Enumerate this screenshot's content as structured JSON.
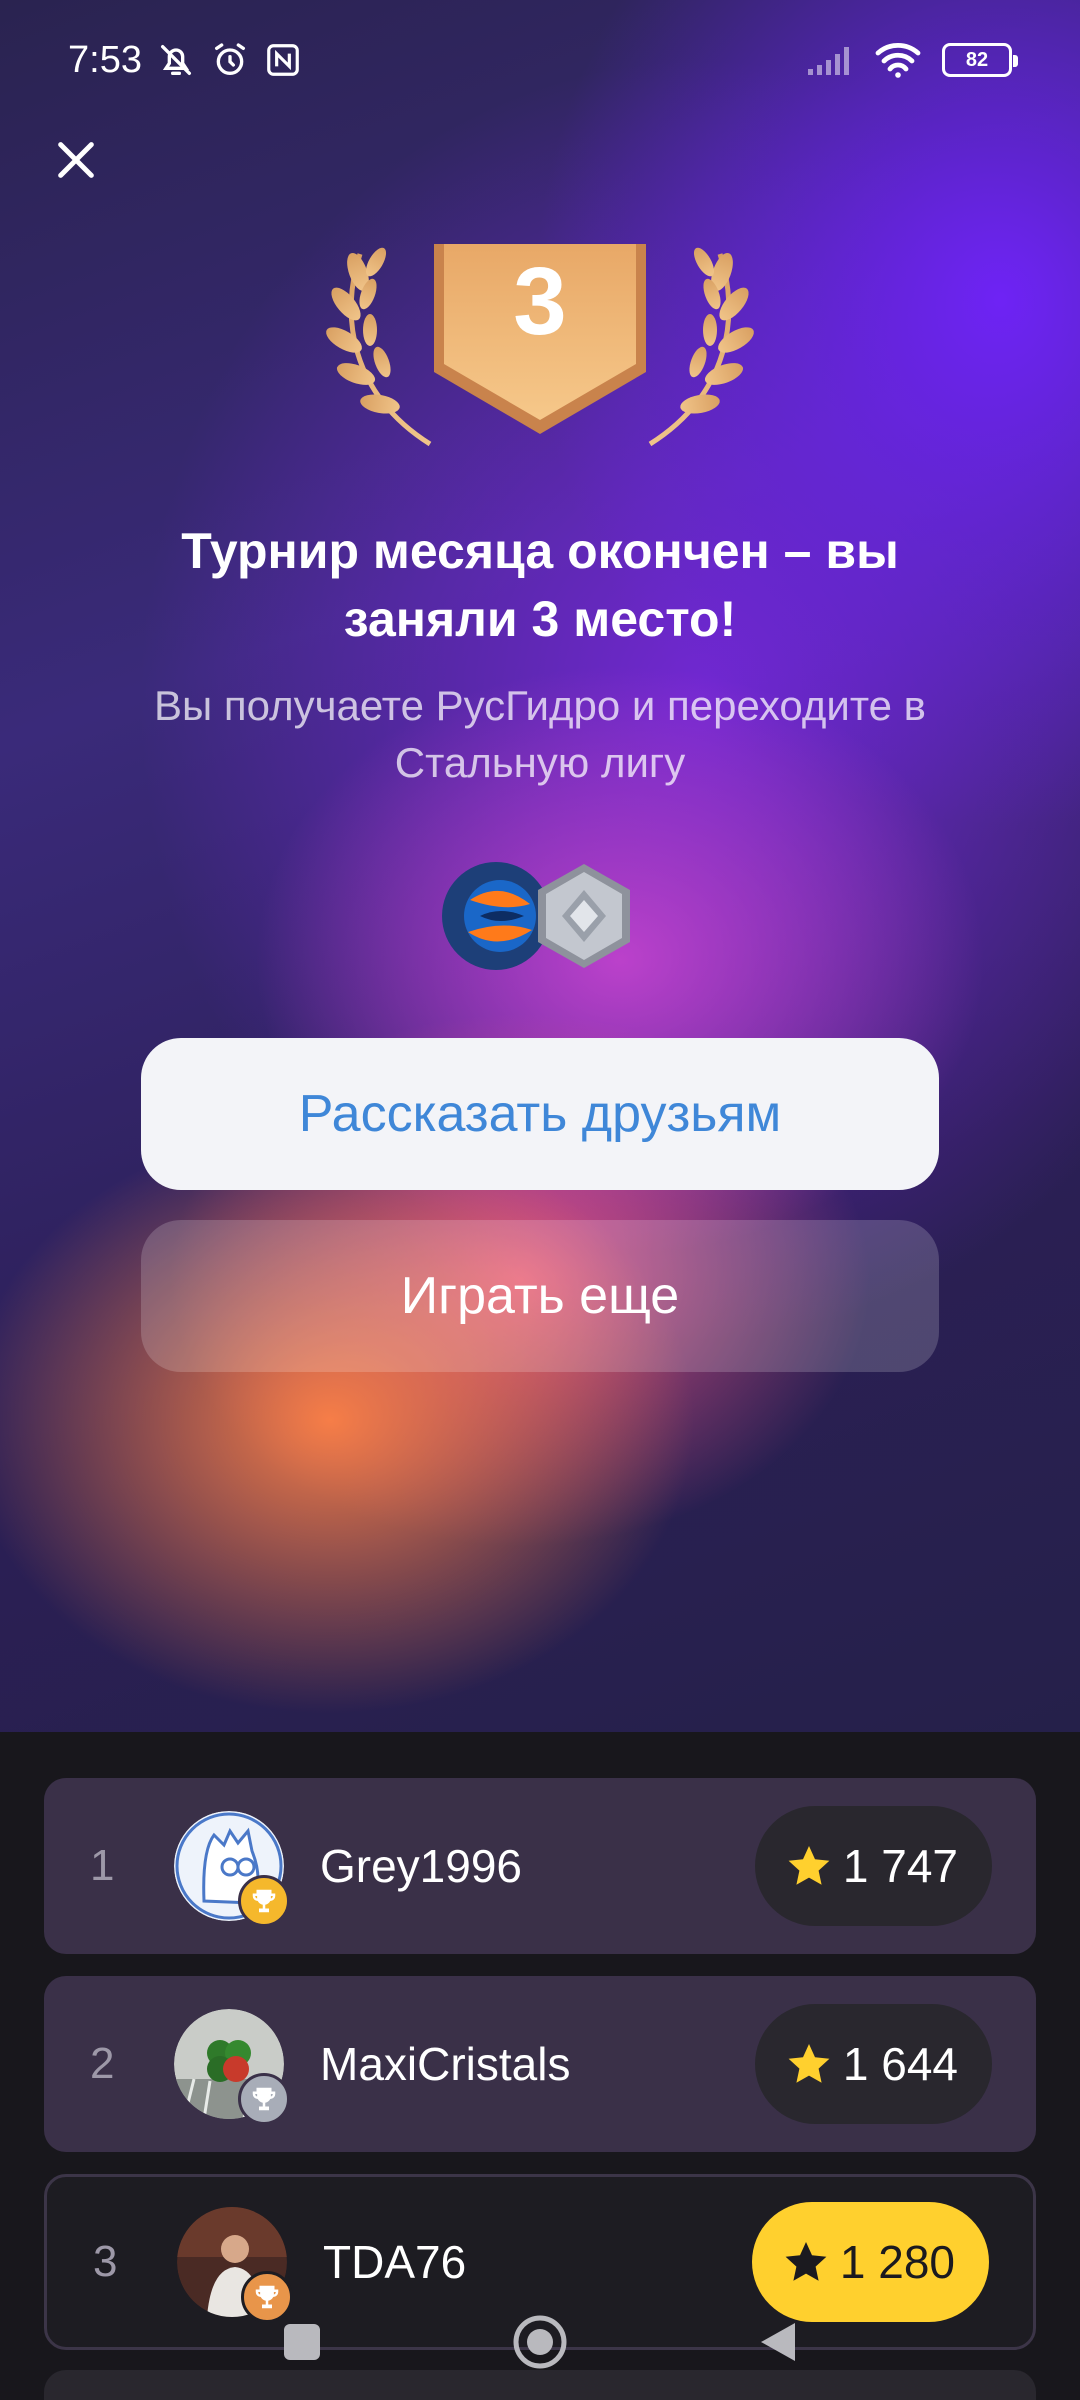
{
  "status_bar": {
    "time": "7:53",
    "battery": "82",
    "icons": [
      "bell-off-icon",
      "alarm-icon",
      "nfc-icon",
      "signal-icon",
      "wifi-icon",
      "battery-icon"
    ]
  },
  "header": {
    "close_icon": "close-icon"
  },
  "result": {
    "place_badge": "3",
    "title": "Турнир месяца окончен – вы заняли 3 место!",
    "subtitle": "Вы получаете РусГидро и переходите в Стальную лигу",
    "reward_icons": [
      "rushydro-logo",
      "steel-league-badge-icon"
    ]
  },
  "actions": {
    "share_label": "Рассказать друзьям",
    "play_again_label": "Играть еще"
  },
  "leaderboard": {
    "rows": [
      {
        "rank": "1",
        "name": "Grey1996",
        "score": "1 747",
        "trophy": "gold"
      },
      {
        "rank": "2",
        "name": "MaxiCristals",
        "score": "1 644",
        "trophy": "silver"
      },
      {
        "rank": "3",
        "name": "TDA76",
        "score": "1 280",
        "trophy": "bronze"
      }
    ]
  },
  "colors": {
    "accent_blue": "#3f87d8",
    "score_highlight": "#ffd02e",
    "gold": "#f5b82c",
    "silver": "#a8adb8",
    "bronze": "#e8954a"
  },
  "navbar": {
    "icons": [
      "recents-square-icon",
      "home-circle-icon",
      "back-triangle-icon"
    ]
  }
}
